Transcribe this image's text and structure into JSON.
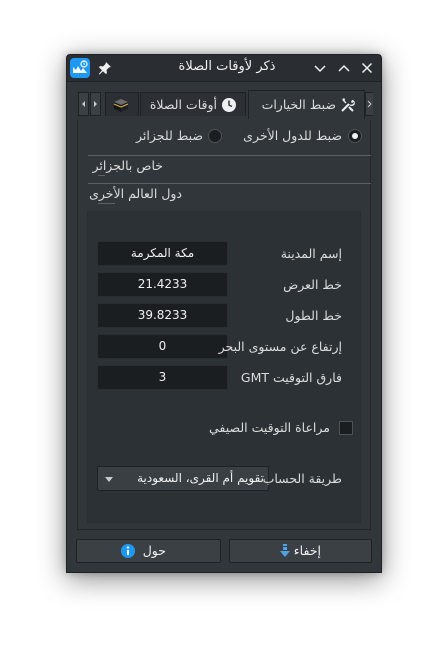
{
  "window": {
    "title": "ذكر لأوقات الصلاة"
  },
  "tabs": [
    {
      "label": "ضبط الخيارات",
      "icon": "tools-icon",
      "active": true
    },
    {
      "label": "أوقات الصلاة",
      "icon": "clock-icon",
      "active": false
    },
    {
      "label": "",
      "icon": "kaaba-icon",
      "active": false
    }
  ],
  "location": {
    "radio_other": "ضبط للدول الأخرى",
    "radio_algeria": "ضبط للجزائر",
    "selected": "other",
    "section_algeria": "خاص بالجزائر",
    "section_world": "دول العالم الأخرى"
  },
  "form": {
    "city_label": "إسم المدينة",
    "city_value": "مكة المكرمة",
    "latitude_label": "خط العرض",
    "latitude_value": "21.4233",
    "longitude_label": "خط الطول",
    "longitude_value": "39.8233",
    "altitude_label": "إرتفاع عن مستوى البحر",
    "altitude_value": "0",
    "gmt_label": "فارق التوقيت GMT",
    "gmt_value": "3",
    "dst_label": "مراعاة التوقيت الصيفي",
    "dst_checked": false,
    "method_label": "طريقة الحساب",
    "method_value": "تقويم أم القرى، السعودية"
  },
  "buttons": {
    "hide": "إخفاء",
    "about": "حول"
  },
  "colors": {
    "accent": "#1d99f3",
    "background": "#31363b",
    "field": "#1b1e20"
  }
}
